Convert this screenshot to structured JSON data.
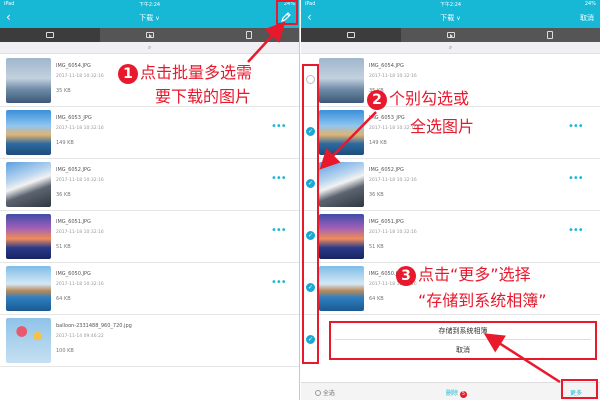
{
  "status": {
    "device": "iPad",
    "time": "下午2:24",
    "battery": "24%"
  },
  "nav": {
    "title": "下载",
    "cancel": "取消"
  },
  "tabs": [
    "photos",
    "videos",
    "documents"
  ],
  "files": [
    {
      "name": "IMG_6054.JPG",
      "date": "2017-11-18 10:32:16",
      "size": "35 KB"
    },
    {
      "name": "IMG_6053_JPG",
      "date": "2017-11-18 10:32:16",
      "size": "149 KB"
    },
    {
      "name": "IMG_6052.JPG",
      "date": "2017-11-18 10:32:16",
      "size": "36 KB"
    },
    {
      "name": "IMG_6051.JPG",
      "date": "2017-11-18 10:32:16",
      "size": "51 KB"
    },
    {
      "name": "IMG_6050.JPG",
      "date": "2017-11-18 10:32:16",
      "size": "64 KB"
    },
    {
      "name": "balloon-2331488_960_720.jpg",
      "date": "2017-11-14 09:46:22",
      "size": "100 KB"
    }
  ],
  "annotations": {
    "step1_line1": "点击批量多选需",
    "step1_line2": "要下载的图片",
    "step2_line1": "个别勾选或",
    "step2_line2": "全选图片",
    "step3_line1": "点击“更多”选择",
    "step3_line2": "“存储到系统相簿”",
    "num1": "1",
    "num2": "2",
    "num3": "3"
  },
  "sheet": {
    "save": "存储到系统相簿",
    "cancel": "取消"
  },
  "bottom": {
    "select_all": "全选",
    "delete": "删除",
    "delete_count": "5",
    "more": "更多"
  },
  "colors": {
    "accent": "#16b8d6",
    "annotation": "#e8192c",
    "check": "#1aa8d4"
  },
  "icons": {
    "back": "chevron-left-icon",
    "edit": "pencil-icon",
    "search": "search-icon",
    "more": "ellipsis-icon"
  }
}
